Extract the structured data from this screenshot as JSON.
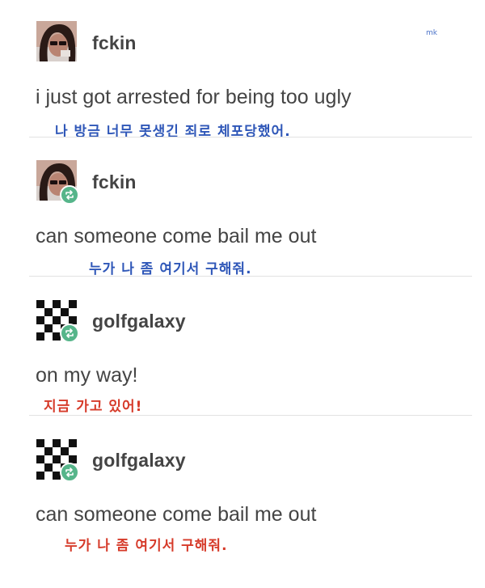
{
  "watermark": "mk",
  "colors": {
    "translation_blue": "#2f57b8",
    "translation_red": "#d63b2a",
    "reblog_badge": "#56b58a",
    "divider": "#e2e2e2"
  },
  "posts": [
    {
      "username": "fckin",
      "avatar": "person-photo-avatar",
      "reblog_badge": false,
      "text": "i just got arrested for being too ugly",
      "translation": "나 방금 너무 못생긴 죄로 체포당했어.",
      "translation_color": "blue"
    },
    {
      "username": "fckin",
      "avatar": "person-photo-avatar",
      "reblog_badge": true,
      "text": "can someone come bail me out",
      "translation": "누가 나 좀 여기서 구해줘.",
      "translation_color": "blue"
    },
    {
      "username": "golfgalaxy",
      "avatar": "checkerboard-avatar",
      "reblog_badge": true,
      "text": "on my way!",
      "translation": "지금 가고 있어!",
      "translation_color": "red"
    },
    {
      "username": "golfgalaxy",
      "avatar": "checkerboard-avatar",
      "reblog_badge": true,
      "text": "can someone come bail me out",
      "translation": "누가 나 좀 여기서 구해줘.",
      "translation_color": "red"
    }
  ]
}
